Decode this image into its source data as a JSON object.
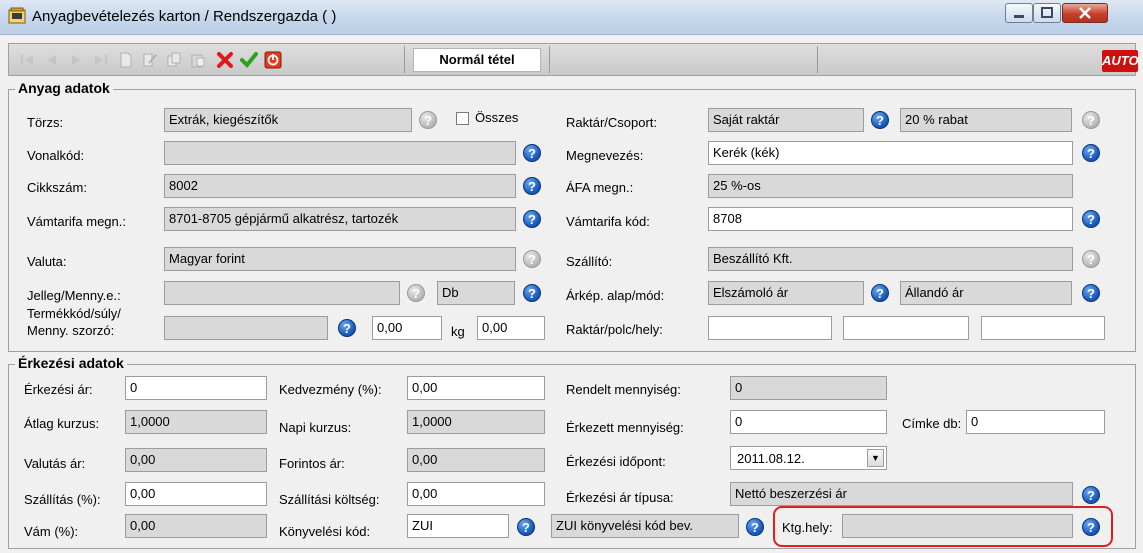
{
  "window": {
    "title": "Anyagbevételezés karton / Rendszergazda ( )",
    "colors": {
      "title_bar": "#c9d9ec",
      "close_button": "#c6402b",
      "help_blue": "#1d5fc2",
      "highlight": "#e02020"
    }
  },
  "toolbar": {
    "mode_label": "Normál tétel",
    "logo_text": "AUTO",
    "icons": [
      "first-icon",
      "prev-icon",
      "next-icon",
      "last-icon",
      "new-icon",
      "edit-icon",
      "copy-icon",
      "paste-icon",
      "delete-icon",
      "accept-icon",
      "stop-icon"
    ]
  },
  "anyag": {
    "section_title": "Anyag adatok",
    "torzs_label": "Törzs:",
    "torzs_value": "Extrák, kiegészítők",
    "osszes_label": "Összes",
    "raktar_label": "Raktár/Csoport:",
    "raktar_value": "Saját raktár",
    "csoport_value": "20 % rabat",
    "vonalkod_label": "Vonalkód:",
    "vonalkod_value": "",
    "megnevezes_label": "Megnevezés:",
    "megnevezes_value": "Kerék (kék)",
    "cikkszam_label": "Cikkszám:",
    "cikkszam_value": "8002",
    "afa_label": "ÁFA megn.:",
    "afa_value": "25 %-os",
    "vamtarifa_megn_label": "Vámtarifa megn.:",
    "vamtarifa_megn_value": "8701-8705 gépjármű alkatrész, tartozék",
    "vamtarifa_kod_label": "Vámtarifa kód:",
    "vamtarifa_kod_value": "8708",
    "valuta_label": "Valuta:",
    "valuta_value": "Magyar forint",
    "szallito_label": "Szállító:",
    "szallito_value": "Beszállító Kft.",
    "jelleg_label": "Jelleg/Menny.e.:",
    "jelleg_value": "",
    "menny_value": "Db",
    "arkep_label": "Árkép. alap/mód:",
    "arkep_alap_value": "Elszámoló ár",
    "arkep_mod_value": "Állandó ár",
    "termekkod_label_1": "Termékkód/súly/",
    "termekkod_label_2": "Menny. szorzó:",
    "termekkod_value": "",
    "suly_value": "0,00",
    "suly_unit": "kg",
    "szorzo_value": "0,00",
    "polc_label": "Raktár/polc/hely:",
    "polc_1": "",
    "polc_2": "",
    "polc_3": ""
  },
  "erkezes": {
    "section_title": "Érkezési adatok",
    "erkezesi_ar_label": "Érkezési ár:",
    "erkezesi_ar_value": "0",
    "kedvezmeny_label": "Kedvezmény (%):",
    "kedvezmeny_value": "0,00",
    "rendelt_label": "Rendelt mennyiség:",
    "rendelt_value": "0",
    "atlag_kurzus_label": "Átlag kurzus:",
    "atlag_kurzus_value": "1,0000",
    "napi_kurzus_label": "Napi kurzus:",
    "napi_kurzus_value": "1,0000",
    "erkezett_label": "Érkezett mennyiség:",
    "erkezett_value": "0",
    "cimke_label": "Címke db:",
    "cimke_value": "0",
    "valutas_ar_label": "Valutás ár:",
    "valutas_ar_value": "0,00",
    "forintos_ar_label": "Forintos ár:",
    "forintos_ar_value": "0,00",
    "idopont_label": "Érkezési időpont:",
    "idopont_value": "2011.08.12.",
    "szallitas_label": "Szállítás (%):",
    "szallitas_value": "0,00",
    "szallitasi_koltseg_label": "Szállítási költség:",
    "szallitasi_koltseg_value": "0,00",
    "ar_tipus_label": "Érkezési ár típusa:",
    "ar_tipus_value": "Nettó beszerzési ár",
    "vam_label": "Vám (%):",
    "vam_value": "0,00",
    "konyvelesi_kod_label": "Könyvelési kód:",
    "konyvelesi_kod_value": "ZUI",
    "konyvelesi_kod_desc": "ZUI könyvelési kód bev.",
    "ktg_hely_label": "Ktg.hely:",
    "ktg_hely_value": ""
  }
}
